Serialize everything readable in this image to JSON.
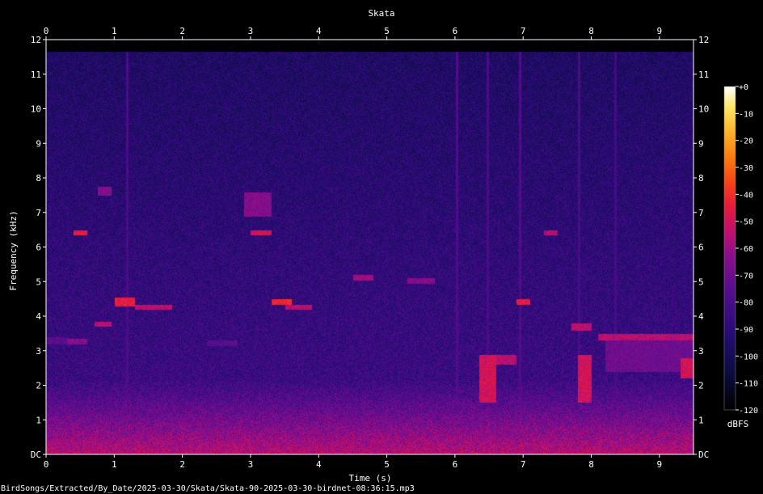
{
  "chart_data": {
    "type": "heatmap",
    "title": "Skata",
    "xlabel": "Time (s)",
    "ylabel": "Frequency (kHz)",
    "xlim": [
      0,
      9.5
    ],
    "ylim": [
      0,
      12
    ],
    "x_ticks": [
      "0",
      "1",
      "2",
      "3",
      "4",
      "5",
      "6",
      "7",
      "8",
      "9"
    ],
    "y_ticks": [
      "DC",
      "1",
      "2",
      "3",
      "4",
      "5",
      "6",
      "7",
      "8",
      "9",
      "10",
      "11",
      "12"
    ],
    "colorbar": {
      "label": "dBFS",
      "range": [
        -120,
        0
      ],
      "ticks": [
        "+0",
        "-10",
        "-20",
        "-30",
        "-40",
        "-50",
        "-60",
        "-70",
        "-80",
        "-90",
        "-100",
        "-110",
        "-120"
      ],
      "colors": [
        "#000000",
        "#0c0c42",
        "#2a0b7a",
        "#5a0d8f",
        "#8e0e8a",
        "#c6106a",
        "#e81a3a",
        "#f7401a",
        "#fb7a0e",
        "#fdb32a",
        "#fee86a",
        "#ffffff"
      ]
    },
    "grid": false,
    "background_level_db": -95,
    "low_band_level_db": -55,
    "events": [
      {
        "t": [
          0.0,
          0.3
        ],
        "f": [
          3.2,
          3.4
        ],
        "db": -75
      },
      {
        "t": [
          0.3,
          0.6
        ],
        "f": [
          3.2,
          3.35
        ],
        "db": -65
      },
      {
        "t": [
          0.4,
          0.6
        ],
        "f": [
          6.35,
          6.5
        ],
        "db": -45
      },
      {
        "t": [
          0.75,
          0.95
        ],
        "f": [
          7.5,
          7.75
        ],
        "db": -65
      },
      {
        "t": [
          0.7,
          0.95
        ],
        "f": [
          3.7,
          3.85
        ],
        "db": -55
      },
      {
        "t": [
          1.0,
          1.3
        ],
        "f": [
          4.3,
          4.55
        ],
        "db": -45
      },
      {
        "t": [
          1.3,
          1.85
        ],
        "f": [
          4.2,
          4.35
        ],
        "db": -55
      },
      {
        "t": [
          2.35,
          2.8
        ],
        "f": [
          3.15,
          3.3
        ],
        "db": -75
      },
      {
        "t": [
          2.9,
          3.3
        ],
        "f": [
          6.9,
          7.6
        ],
        "db": -65
      },
      {
        "t": [
          3.0,
          3.3
        ],
        "f": [
          6.35,
          6.5
        ],
        "db": -50
      },
      {
        "t": [
          3.3,
          3.6
        ],
        "f": [
          4.35,
          4.5
        ],
        "db": -42
      },
      {
        "t": [
          3.5,
          3.9
        ],
        "f": [
          4.2,
          4.35
        ],
        "db": -55
      },
      {
        "t": [
          4.5,
          4.8
        ],
        "f": [
          5.05,
          5.2
        ],
        "db": -60
      },
      {
        "t": [
          5.3,
          5.7
        ],
        "f": [
          4.95,
          5.1
        ],
        "db": -65
      },
      {
        "t": [
          6.35,
          6.6
        ],
        "f": [
          1.5,
          2.9
        ],
        "db": -50
      },
      {
        "t": [
          6.5,
          6.9
        ],
        "f": [
          2.6,
          2.9
        ],
        "db": -55
      },
      {
        "t": [
          6.9,
          7.1
        ],
        "f": [
          4.35,
          4.5
        ],
        "db": -45
      },
      {
        "t": [
          7.3,
          7.5
        ],
        "f": [
          6.35,
          6.5
        ],
        "db": -55
      },
      {
        "t": [
          7.7,
          8.0
        ],
        "f": [
          3.6,
          3.8
        ],
        "db": -55
      },
      {
        "t": [
          7.8,
          8.0
        ],
        "f": [
          1.5,
          2.9
        ],
        "db": -50
      },
      {
        "t": [
          8.1,
          9.5
        ],
        "f": [
          3.3,
          3.5
        ],
        "db": -55
      },
      {
        "t": [
          8.2,
          9.5
        ],
        "f": [
          2.4,
          3.3
        ],
        "db": -70
      },
      {
        "t": [
          9.3,
          9.5
        ],
        "f": [
          2.2,
          2.8
        ],
        "db": -50
      }
    ],
    "vertical_streaks": [
      {
        "t": 1.19,
        "db": -80
      },
      {
        "t": 6.03,
        "db": -78
      },
      {
        "t": 6.48,
        "db": -80
      },
      {
        "t": 6.95,
        "db": -78
      },
      {
        "t": 7.82,
        "db": -80
      },
      {
        "t": 8.35,
        "db": -82
      }
    ],
    "footer": "BirdSongs/Extracted/By_Date/2025-03-30/Skata/Skata-90-2025-03-30-birdnet-08:36:15.mp3"
  }
}
